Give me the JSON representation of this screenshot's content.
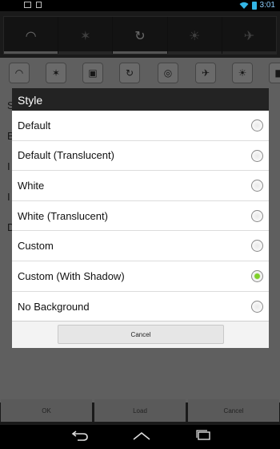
{
  "status_bar": {
    "time": "3:01",
    "left_icons": [
      "image-icon",
      "document-icon"
    ],
    "right_icons": [
      "wifi-icon",
      "battery-icon"
    ]
  },
  "power_widget": {
    "buttons": [
      {
        "icon": "wifi-icon",
        "glyph": "◠",
        "on": true
      },
      {
        "icon": "bluetooth-icon",
        "glyph": "✶",
        "on": false
      },
      {
        "icon": "sync-icon",
        "glyph": "↻",
        "on": true
      },
      {
        "icon": "brightness-icon",
        "glyph": "☀",
        "on": false
      },
      {
        "icon": "airplane-icon",
        "glyph": "✈",
        "on": false
      }
    ]
  },
  "background_page": {
    "toggle_icons": [
      "wifi-icon",
      "bluetooth-icon",
      "data-icon",
      "sync-icon",
      "gps-icon",
      "airplane-icon",
      "brightness-icon",
      "lock-icon"
    ],
    "toggle_glyphs": [
      "◠",
      "✶",
      "▣",
      "↻",
      "◎",
      "✈",
      "☀",
      "■"
    ],
    "visible_letters": [
      "S",
      "B",
      "I",
      "I",
      "D"
    ]
  },
  "dialog": {
    "title": "Style",
    "options": [
      {
        "label": "Default",
        "checked": false
      },
      {
        "label": "Default (Translucent)",
        "checked": false
      },
      {
        "label": "White",
        "checked": false
      },
      {
        "label": "White (Translucent)",
        "checked": false
      },
      {
        "label": "Custom",
        "checked": false
      },
      {
        "label": "Custom (With Shadow)",
        "checked": true
      },
      {
        "label": "No Background",
        "checked": false
      }
    ],
    "cancel_label": "Cancel"
  },
  "bottom_bar": {
    "ok_label": "OK",
    "load_label": "Load",
    "cancel_label": "Cancel"
  },
  "nav_bar": {
    "back_icon": "back-icon",
    "home_icon": "home-icon",
    "recents_icon": "recents-icon"
  },
  "colors": {
    "accent_green": "#7fcf2a",
    "status_blue": "#33b5e5"
  }
}
